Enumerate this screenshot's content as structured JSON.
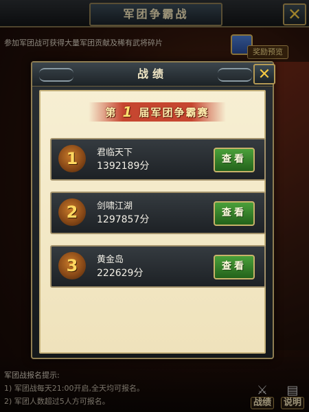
{
  "background": {
    "title": "军团争霸战",
    "description": "参加军团战可获得大量军团贡献及稀有武将碎片",
    "reward_preview_label": "奖励预览",
    "rules_title": "军团战报名提示:",
    "rules": [
      "1)  军团战每天21:00开启,全天均可报名。",
      "2)  军团人数超过5人方可报名。"
    ],
    "bottom_buttons": {
      "record": "战绩",
      "help": "说明"
    }
  },
  "modal": {
    "title": "战绩",
    "banner": {
      "prefix": "第",
      "number": "1",
      "suffix": "届军团争霸赛"
    },
    "rankings": [
      {
        "rank": "1",
        "name": "君临天下",
        "score": "1392189分",
        "button": "查看"
      },
      {
        "rank": "2",
        "name": "剑啸江湖",
        "score": "1297857分",
        "button": "查看"
      },
      {
        "rank": "3",
        "name": "黄金岛",
        "score": "222629分",
        "button": "查看"
      }
    ]
  },
  "colors": {
    "gold_border": "#a2916a",
    "view_button_green": "#4aa03a",
    "banner_red": "#be2814",
    "parchment": "#f7efd3"
  },
  "icons": {
    "close": "close-icon",
    "chest": "chest-icon",
    "swords": "crossed-swords-icon",
    "scroll": "scroll-icon"
  }
}
